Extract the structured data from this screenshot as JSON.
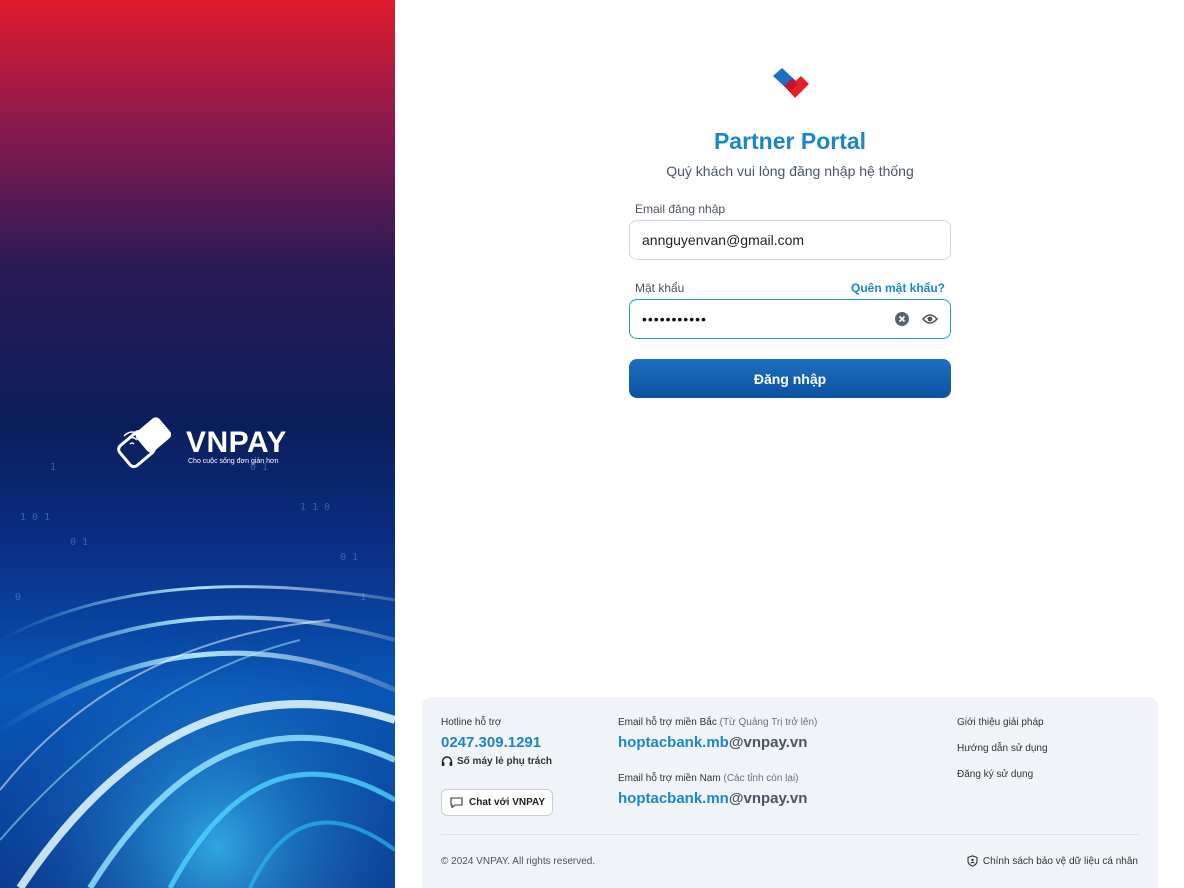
{
  "hero": {
    "brand_name": "VNPAY",
    "brand_tagline": "Cho cuộc sống đơn giản hơn"
  },
  "login": {
    "title": "Partner Portal",
    "subtitle": "Quý khách vui lòng đăng nhập hệ thống",
    "email_label": "Email đăng nhập",
    "email_value": "annguyenvan@gmail.com",
    "password_label": "Mật khẩu",
    "forgot_label": "Quên mật khẩu?",
    "password_masked": "•••••••••••",
    "submit_label": "Đăng nhập",
    "icons": [
      "clear-icon",
      "eye-icon"
    ]
  },
  "footer": {
    "hotline_label": "Hotline hỗ trợ",
    "hotline_number": "0247.309.1291",
    "ext_label": "Số máy lẻ phụ trách",
    "chat_label": "Chat với VNPAY",
    "north": {
      "label": "Email hỗ trợ miền Bắc",
      "note": "(Từ Quảng Trị trở lên)",
      "email_user": "hoptacbank.mb",
      "email_domain": "@vnpay.vn"
    },
    "south": {
      "label": "Email hỗ trợ miền Nam",
      "note": "(Các tỉnh còn lại)",
      "email_user": "hoptacbank.mn",
      "email_domain": "@vnpay.vn"
    },
    "links": [
      "Giới thiệu giải pháp",
      "Hướng dẫn sử dụng",
      "Đăng ký sử dụng"
    ],
    "copyright": "© 2024 VNPAY. All rights reserved.",
    "policy_label": "Chính sách bảo vệ dữ liệu cá nhân"
  },
  "colors": {
    "accent": "#1b87c6",
    "button": "#0c52a0",
    "footer_bg": "#f0f3f7"
  }
}
